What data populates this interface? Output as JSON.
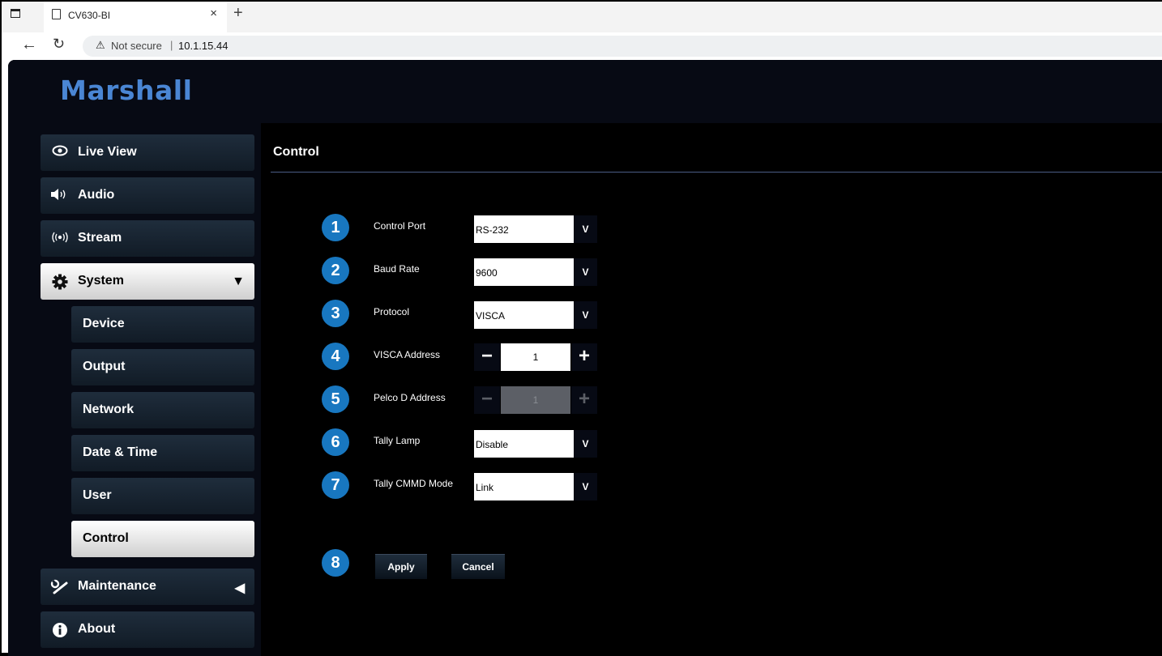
{
  "browser": {
    "tab_title": "CV630-BI",
    "tab_close": "×",
    "new_tab": "+",
    "security_icon": "⚠",
    "security_text": "Not secure",
    "separator": "|",
    "url": "10.1.15.44"
  },
  "header": {
    "logo": "Marshall"
  },
  "sidebar": {
    "items": [
      {
        "label": "Live View",
        "icon": "eye-icon"
      },
      {
        "label": "Audio",
        "icon": "speaker-icon"
      },
      {
        "label": "Stream",
        "icon": "broadcast-icon"
      },
      {
        "label": "System",
        "icon": "gear-icon",
        "arrow": "▼"
      },
      {
        "label": "Device"
      },
      {
        "label": "Output"
      },
      {
        "label": "Network"
      },
      {
        "label": "Date & Time"
      },
      {
        "label": "User"
      },
      {
        "label": "Control"
      },
      {
        "label": "Maintenance",
        "icon": "wrench-icon",
        "arrow": "◀"
      },
      {
        "label": "About",
        "icon": "info-icon"
      }
    ],
    "active": "Control"
  },
  "main": {
    "title": "Control",
    "fields": [
      {
        "num": "1",
        "label": "Control Port",
        "type": "select",
        "value": "RS-232"
      },
      {
        "num": "2",
        "label": "Baud Rate",
        "type": "select",
        "value": "9600"
      },
      {
        "num": "3",
        "label": "Protocol",
        "type": "select",
        "value": "VISCA"
      },
      {
        "num": "4",
        "label": "VISCA Address",
        "type": "stepper",
        "value": "1",
        "enabled": true
      },
      {
        "num": "5",
        "label": "Pelco D Address",
        "type": "stepper",
        "value": "1",
        "enabled": false
      },
      {
        "num": "6",
        "label": "Tally Lamp",
        "type": "select",
        "value": "Disable"
      },
      {
        "num": "7",
        "label": "Tally CMMD Mode",
        "type": "select",
        "value": "Link"
      }
    ],
    "select_chevron": "V",
    "stepper_minus": "−",
    "stepper_plus": "+",
    "actions_num": "8",
    "apply_label": "Apply",
    "cancel_label": "Cancel"
  },
  "colors": {
    "accent_blue": "#1877c0",
    "logo_blue": "#4a86d4",
    "nav_dark": "#1f2d3c",
    "background": "#000000"
  }
}
